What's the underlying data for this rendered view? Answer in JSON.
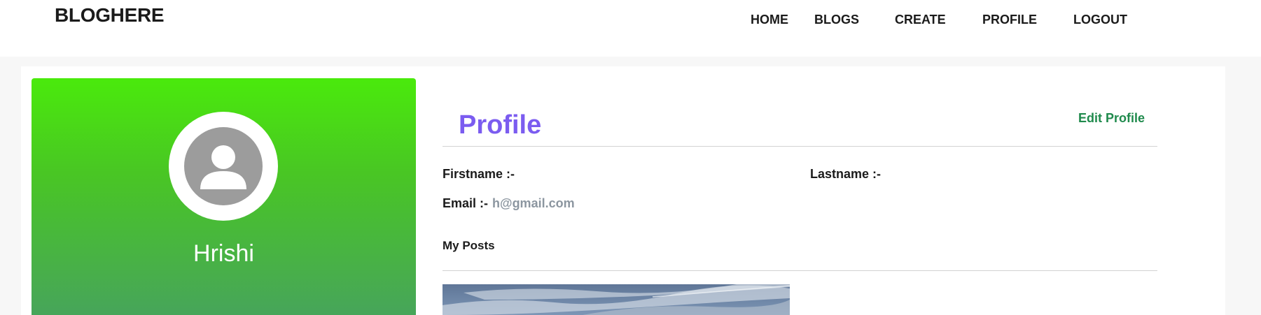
{
  "brand": "BLOGHERE",
  "nav": {
    "home": "HOME",
    "blogs": "BLOGS",
    "create": "CREATE",
    "profile": "PROFILE",
    "logout": "LOGOUT"
  },
  "user": {
    "name": "Hrishi",
    "avatar_icon": "user-avatar-icon"
  },
  "profile": {
    "title": "Profile",
    "edit_label": "Edit Profile",
    "firstname_label": "Firstname :-",
    "firstname_value": "",
    "lastname_label": "Lastname :-",
    "lastname_value": "",
    "email_label": "Email :-",
    "email_value": "h@gmail.com"
  },
  "posts": {
    "heading": "My Posts"
  },
  "colors": {
    "accent_purple": "#7b5cf0",
    "edit_green": "#1f8a4c",
    "panel_green_top": "#4aea0c",
    "panel_green_bottom": "#47a55a"
  }
}
